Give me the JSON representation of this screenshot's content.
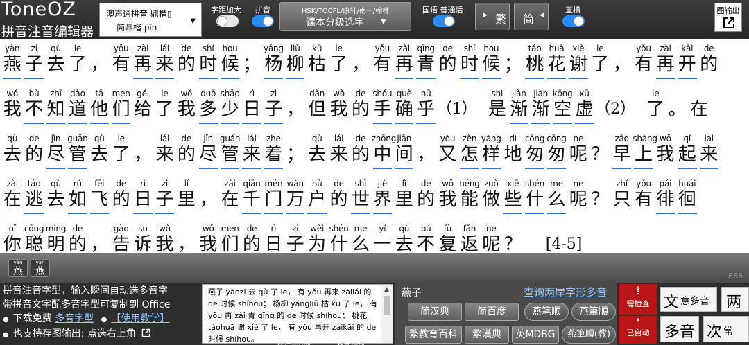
{
  "app": {
    "logo_title": "ToneOZ",
    "logo_subtitle": "拼音注音编辑器"
  },
  "toolbar": {
    "font_select_line1": "澳声通拼音 鼎楷▯",
    "font_select_line2": "简鼎楷 pīn",
    "spacing_label": "字距加大",
    "pinyin_label": "拼音",
    "grade_top": "HSK/TOCFL/康轩/南一/翰林",
    "grade_main": "课本分级选字",
    "guoyu_label": "国语 普通话",
    "trad_label": "繁",
    "simp_label": "简",
    "vertical_label": "直横",
    "export_label": "图输出",
    "toggles": {
      "spacing": false,
      "pinyin": true,
      "guoyu": true,
      "vertical": true
    }
  },
  "content": {
    "lines": [
      [
        [
          "yàn",
          "燕",
          1
        ],
        [
          "zi",
          "子",
          1
        ],
        [
          "qù",
          "去",
          0
        ],
        [
          "le",
          "了",
          0
        ],
        [
          "",
          "，",
          0
        ],
        [
          "yǒu",
          "有",
          0
        ],
        [
          "zài",
          "再",
          1
        ],
        [
          "lái",
          "来",
          1
        ],
        [
          "de",
          "的",
          0
        ],
        [
          "shí",
          "时",
          1
        ],
        [
          "hou",
          "候",
          1
        ],
        [
          "",
          "；",
          0
        ],
        [
          "yáng",
          "杨",
          1
        ],
        [
          "liǔ",
          "柳",
          1
        ],
        [
          "kū",
          "枯",
          0
        ],
        [
          "le",
          "了",
          0
        ],
        [
          "",
          "，",
          0
        ],
        [
          "yǒu",
          "有",
          0
        ],
        [
          "zài",
          "再",
          1
        ],
        [
          "qīng",
          "青",
          1
        ],
        [
          "de",
          "的",
          0
        ],
        [
          "shí",
          "时",
          1
        ],
        [
          "hou",
          "候",
          1
        ],
        [
          "",
          "；",
          0
        ],
        [
          "táo",
          "桃",
          1
        ],
        [
          "huā",
          "花",
          1
        ],
        [
          "xiè",
          "谢",
          1
        ],
        [
          "le",
          "了",
          0
        ],
        [
          "",
          "，",
          0
        ],
        [
          "yǒu",
          "有",
          0
        ],
        [
          "zài",
          "再",
          1
        ],
        [
          "kāi",
          "开",
          1
        ],
        [
          "de",
          "的",
          0
        ]
      ],
      [
        [
          "wǒ",
          "我",
          0
        ],
        [
          "bù",
          "不",
          1
        ],
        [
          "zhī",
          "知",
          1
        ],
        [
          "dào",
          "道",
          1
        ],
        [
          "tā",
          "他",
          1
        ],
        [
          "men",
          "们",
          1
        ],
        [
          "gěi",
          "给",
          0
        ],
        [
          "le",
          "了",
          0
        ],
        [
          "wǒ",
          "我",
          0
        ],
        [
          "duō",
          "多",
          1
        ],
        [
          "shǎo",
          "少",
          1
        ],
        [
          "rì",
          "日",
          1
        ],
        [
          "zi",
          "子",
          1
        ],
        [
          "",
          "，",
          0
        ],
        [
          "dàn",
          "但",
          0
        ],
        [
          "wǒ",
          "我",
          0
        ],
        [
          "de",
          "的",
          0
        ],
        [
          "shǒu",
          "手",
          1
        ],
        [
          "què",
          "确",
          1
        ],
        [
          "hū",
          "乎",
          1
        ],
        [
          "",
          "（1）",
          0
        ],
        [
          "",
          "",
          0
        ],
        [
          "shì",
          "是",
          0
        ],
        [
          "jiàn",
          "渐",
          1
        ],
        [
          "jiàn",
          "渐",
          1
        ],
        [
          "kōng",
          "空",
          1
        ],
        [
          "xū",
          "虚",
          1
        ],
        [
          "",
          "（2）",
          0
        ],
        [
          "",
          "",
          0
        ],
        [
          "le",
          "了",
          0
        ],
        [
          "",
          "。",
          0
        ],
        [
          "",
          "在",
          0
        ]
      ],
      [
        [
          "qù",
          "去",
          0
        ],
        [
          "de",
          "的",
          0
        ],
        [
          "jǐn",
          "尽",
          1
        ],
        [
          "guǎn",
          "管",
          1
        ],
        [
          "qù",
          "去",
          0
        ],
        [
          "le",
          "了",
          0
        ],
        [
          "",
          "，",
          0
        ],
        [
          "lái",
          "来",
          0
        ],
        [
          "de",
          "的",
          0
        ],
        [
          "jǐn",
          "尽",
          1
        ],
        [
          "guǎn",
          "管",
          1
        ],
        [
          "lái",
          "来",
          1
        ],
        [
          "zhe",
          "着",
          1
        ],
        [
          "",
          "；",
          0
        ],
        [
          "qù",
          "去",
          0
        ],
        [
          "lái",
          "来",
          0
        ],
        [
          "de",
          "的",
          0
        ],
        [
          "zhōng",
          "中",
          1
        ],
        [
          "jiān",
          "间",
          1
        ],
        [
          "",
          "，",
          0
        ],
        [
          "yòu",
          "又",
          0
        ],
        [
          "zěn",
          "怎",
          1
        ],
        [
          "yàng",
          "样",
          1
        ],
        [
          "dì",
          "地",
          0
        ],
        [
          "cōng",
          "匆",
          1
        ],
        [
          "cōng",
          "匆",
          1
        ],
        [
          "ne",
          "呢",
          0
        ],
        [
          "",
          "？",
          0
        ],
        [
          "zǎo",
          "早",
          1
        ],
        [
          "shàng",
          "上",
          1
        ],
        [
          "wǒ",
          "我",
          0
        ],
        [
          "qǐ",
          "起",
          1
        ],
        [
          "lai",
          "来",
          1
        ]
      ],
      [
        [
          "zài",
          "在",
          0
        ],
        [
          "táo",
          "逃",
          1
        ],
        [
          "qù",
          "去",
          0
        ],
        [
          "rú",
          "如",
          1
        ],
        [
          "fēi",
          "飞",
          1
        ],
        [
          "de",
          "的",
          0
        ],
        [
          "rì",
          "日",
          1
        ],
        [
          "zi",
          "子",
          1
        ],
        [
          "lǐ",
          "里",
          0
        ],
        [
          "",
          "，",
          0
        ],
        [
          "zài",
          "在",
          0
        ],
        [
          "qiān",
          "千",
          1
        ],
        [
          "mén",
          "门",
          1
        ],
        [
          "wàn",
          "万",
          1
        ],
        [
          "hù",
          "户",
          1
        ],
        [
          "de",
          "的",
          0
        ],
        [
          "shì",
          "世",
          1
        ],
        [
          "jiè",
          "界",
          1
        ],
        [
          "lǐ",
          "里",
          0
        ],
        [
          "de",
          "的",
          0
        ],
        [
          "wǒ",
          "我",
          0
        ],
        [
          "néng",
          "能",
          0
        ],
        [
          "zuò",
          "做",
          0
        ],
        [
          "xiē",
          "些",
          1
        ],
        [
          "shén",
          "什",
          1
        ],
        [
          "me",
          "么",
          1
        ],
        [
          "ne",
          "呢",
          0
        ],
        [
          "",
          "？",
          0
        ],
        [
          "zhǐ",
          "只",
          0
        ],
        [
          "yǒu",
          "有",
          0
        ],
        [
          "pái",
          "徘",
          1
        ],
        [
          "huái",
          "徊",
          1
        ]
      ],
      [
        [
          "nǐ",
          "你",
          0
        ],
        [
          "cōng",
          "聪",
          1
        ],
        [
          "ming",
          "明",
          1
        ],
        [
          "de",
          "的",
          0
        ],
        [
          "",
          "，",
          0
        ],
        [
          "gào",
          "告",
          1
        ],
        [
          "su",
          "诉",
          1
        ],
        [
          "wǒ",
          "我",
          0
        ],
        [
          "",
          "，",
          0
        ],
        [
          "wǒ",
          "我",
          0
        ],
        [
          "men",
          "们",
          0
        ],
        [
          "de",
          "的",
          0
        ],
        [
          "rì",
          "日",
          1
        ],
        [
          "zi",
          "子",
          1
        ],
        [
          "wèi",
          "为",
          1
        ],
        [
          "shén",
          "什",
          1
        ],
        [
          "me",
          "么",
          1
        ],
        [
          "yí",
          "一",
          1
        ],
        [
          "qù",
          "去",
          1
        ],
        [
          "bú",
          "不",
          1
        ],
        [
          "fù",
          "复",
          1
        ],
        [
          "fǎn",
          "返",
          1
        ],
        [
          "ne",
          "呢",
          0
        ],
        [
          "",
          "？",
          0
        ],
        [
          "",
          "",
          0
        ],
        [
          "",
          "[4-5]",
          0
        ]
      ]
    ]
  },
  "history": [
    {
      "py": "yàn",
      "hz": "燕"
    },
    {
      "py": "yàn",
      "hz": "燕"
    }
  ],
  "counter": "866",
  "bottom": {
    "info_line1": "拼音注音字型，输入瞬间自动选多音字",
    "info_line2": "带拼音文字配多音字型可复制到 Office",
    "info_line3_pre": "下载免费",
    "info_line3_link1": "多音字型",
    "info_line3_link2": "【使用教学】",
    "info_line4": "也支持存图输出: 点选右上角",
    "input_text": "燕子 yànzi 去 qù 了 le， 有 yǒu 再来 zàilái 的 de 时候 shíhou； 杨柳 yángliǔ 枯 kū 了 le， 有 yǒu 再 zài 青 qīng 的 de 时候 shíhou； 桃花 táohuā 谢 xiè 了 le， 有 yǒu 再开 zàikāi 的 de 时候 shíhou。",
    "tab1": "转注音切换",
    "tab2": "格式切换",
    "dict_char": "燕子",
    "dict_link": "查询两岸字形多音",
    "dict_buttons": {
      "simp_handian": "简汉典",
      "simp_baidu": "简百度",
      "stroke1": "燕笔顺",
      "stroke2": "燕筆順",
      "jiaoyu": "繁教育百科",
      "handian": "繁漢典",
      "mdbg": "英MDBG",
      "stroke3": "燕筆順(教)"
    },
    "check_mark": "!",
    "check_label": "需检查",
    "auto_mark": "*",
    "auto_label": "已自动",
    "mode1_big": "文",
    "mode1_small": "意多音",
    "mode2_big": "两",
    "mode3_big": "多音",
    "mode4_big": "次",
    "mode4_small": "常"
  }
}
